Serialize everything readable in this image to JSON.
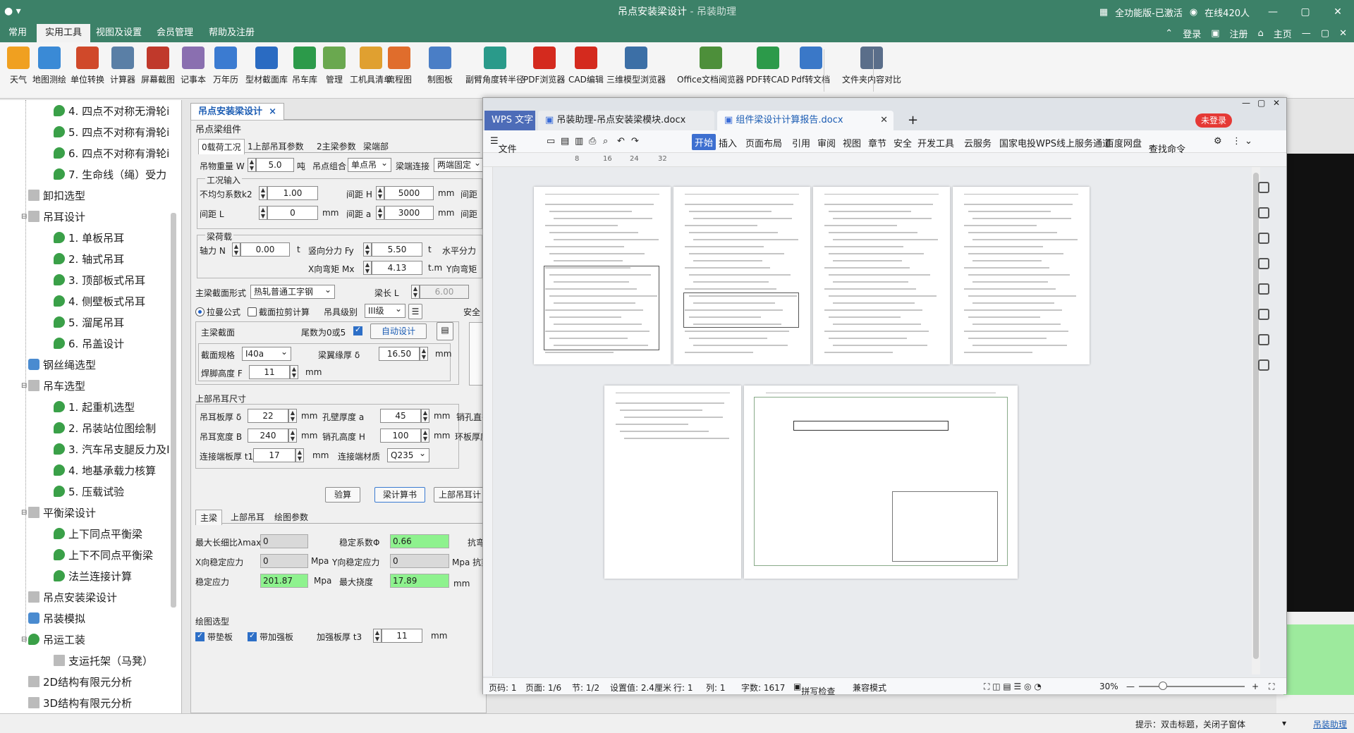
{
  "titlebar": {
    "title": "吊点安装梁设计",
    "subtitle": " - 吊装助理",
    "activation": "全功能版-已激活",
    "online": "在线420人"
  },
  "menubar": {
    "items": [
      "常用",
      "实用工具",
      "视图及设置",
      "会员管理",
      "帮助及注册"
    ],
    "active": "实用工具",
    "right": [
      "登录",
      "注册",
      "主页"
    ]
  },
  "toolbar": {
    "items": [
      {
        "label": "天气",
        "icon": "weather-icon",
        "color": "#f0a020"
      },
      {
        "label": "地图测绘",
        "icon": "map-icon",
        "color": "#3a8ad6"
      },
      {
        "label": "单位转换",
        "icon": "unit-convert-icon",
        "color": "#d0492a"
      },
      {
        "label": "计算器",
        "icon": "calculator-icon",
        "color": "#5a7fa6"
      },
      {
        "label": "屏幕截图",
        "icon": "scissors-icon",
        "color": "#c0392b"
      },
      {
        "label": "记事本",
        "icon": "notepad-icon",
        "color": "#8a6fb0"
      },
      {
        "label": "万年历",
        "icon": "calendar-icon",
        "color": "#3b7bd1"
      },
      {
        "label": "型材截面库",
        "icon": "i-beam-icon",
        "color": "#2a6bc2"
      },
      {
        "label": "吊车库",
        "icon": "crane-lib-icon",
        "color": "#2c9a4a"
      },
      {
        "label": "管理",
        "icon": "manage-icon",
        "color": "#6aa84f"
      },
      {
        "label": "工机具清单",
        "icon": "clipboard-icon",
        "color": "#e0a030"
      },
      {
        "label": "流程图",
        "icon": "flowchart-icon",
        "color": "#e06d2c"
      },
      {
        "label": "制图板",
        "icon": "drawing-board-icon",
        "color": "#4a7ec6"
      },
      {
        "label": "副臂角度转半径",
        "icon": "rotate-icon",
        "color": "#2a9a8a"
      },
      {
        "label": "PDF浏览器",
        "icon": "pdf-icon",
        "color": "#d42a1e"
      },
      {
        "label": "CAD编辑",
        "icon": "cad-icon",
        "color": "#d42a1e"
      },
      {
        "label": "三维模型浏览器",
        "icon": "3d-model-icon",
        "color": "#3c6fa6"
      },
      {
        "label": "Office文档阅览器",
        "icon": "office-doc-icon",
        "color": "#4d8f3a"
      },
      {
        "label": "PDF转CAD",
        "icon": "pdf-to-cad-icon",
        "color": "#2c9a4a"
      },
      {
        "label": "Pdf转文档",
        "icon": "pdf-to-doc-icon",
        "color": "#3a78c8"
      },
      {
        "label": "文件夹内容对比",
        "icon": "folder-compare-icon",
        "color": "#5a6e8a"
      }
    ]
  },
  "tree": {
    "items": [
      {
        "label": "4. 四点不对称无滑轮i",
        "level": 3,
        "icon": "green"
      },
      {
        "label": "5. 四点不对称有滑轮i",
        "level": 3,
        "icon": "green"
      },
      {
        "label": "6. 四点不对称有滑轮i",
        "level": 3,
        "icon": "green"
      },
      {
        "label": "7. 生命线（绳）受力",
        "level": 3,
        "icon": "green"
      },
      {
        "label": "卸扣选型",
        "level": 1,
        "icon": "grey"
      },
      {
        "label": "吊耳设计",
        "level": 1,
        "icon": "grey",
        "expander": "-"
      },
      {
        "label": "1. 单板吊耳",
        "level": 2,
        "icon": "green"
      },
      {
        "label": "2. 轴式吊耳",
        "level": 2,
        "icon": "green"
      },
      {
        "label": "3. 顶部板式吊耳",
        "level": 2,
        "icon": "green"
      },
      {
        "label": "4. 侧壁板式吊耳",
        "level": 2,
        "icon": "green"
      },
      {
        "label": "5. 溜尾吊耳",
        "level": 2,
        "icon": "green"
      },
      {
        "label": "6. 吊盖设计",
        "level": 2,
        "icon": "green"
      },
      {
        "label": "钢丝绳选型",
        "level": 1,
        "icon": "blue"
      },
      {
        "label": "吊车选型",
        "level": 1,
        "icon": "grey",
        "expander": "-"
      },
      {
        "label": "1. 起重机选型",
        "level": 2,
        "icon": "green"
      },
      {
        "label": "2. 吊装站位图绘制",
        "level": 2,
        "icon": "green"
      },
      {
        "label": "3. 汽车吊支腿反力及I",
        "level": 2,
        "icon": "green"
      },
      {
        "label": "4. 地基承载力核算",
        "level": 2,
        "icon": "green"
      },
      {
        "label": "5. 压载试验",
        "level": 2,
        "icon": "green"
      },
      {
        "label": "平衡梁设计",
        "level": 1,
        "icon": "grey",
        "expander": "-"
      },
      {
        "label": "上下同点平衡梁",
        "level": 2,
        "icon": "green"
      },
      {
        "label": "上下不同点平衡梁",
        "level": 2,
        "icon": "green"
      },
      {
        "label": "法兰连接计算",
        "level": 2,
        "icon": "green"
      },
      {
        "label": "吊点安装梁设计",
        "level": 1,
        "icon": "grey"
      },
      {
        "label": "吊装模拟",
        "level": 1,
        "icon": "blue"
      },
      {
        "label": "吊运工装",
        "level": 1,
        "icon": "green",
        "expander": "-"
      },
      {
        "label": "支运托架（马凳）",
        "level": 2,
        "icon": "grey"
      },
      {
        "label": "2D结构有限元分析",
        "level": 1,
        "icon": "grey"
      },
      {
        "label": "3D结构有限元分析",
        "level": 1,
        "icon": "grey"
      }
    ]
  },
  "doc_tab": {
    "label": "吊点安装梁设计",
    "close": "×"
  },
  "form": {
    "group_title": "吊点梁组件",
    "tabs": [
      "0载荷工况",
      "1上部吊耳参数",
      "2主梁参数",
      "梁端部"
    ],
    "row1": {
      "weight_label": "吊物重量 W",
      "weight": "5.0",
      "weight_unit": "吨",
      "combo_label": "吊点组合",
      "combo": "单点吊",
      "end_label": "梁端连接",
      "end": "两端固定"
    },
    "case_group": "工况输入",
    "k2_label": "不均匀系数k2",
    "k2": "1.00",
    "L_label": "间距 L",
    "L": "0",
    "L_unit": "mm",
    "H_label": "间距 H",
    "H": "5000",
    "H_unit": "mm",
    "a_label": "间距 a",
    "a": "3000",
    "a_unit": "mm",
    "more_label": "间距",
    "load_group": "梁荷载",
    "N_label": "轴力 N",
    "N": "0.00",
    "N_unit": "t",
    "Fy_label": "竖向分力 Fy",
    "Fy": "5.50",
    "Fy_unit": "t",
    "Fx_label": "水平分力",
    "Mx_label": "X向弯矩 Mx",
    "Mx": "4.13",
    "Mx_unit": "t.m",
    "My_label": "Y向弯矩",
    "section_form_label": "主梁截面形式",
    "section_form": "热轧普通工字钢",
    "beam_len_label": "梁长 L",
    "beam_len": "6.00",
    "radio1": "拉曼公式",
    "radio2": "截面拉剪计算",
    "grade_label": "吊具级别",
    "grade": "III级",
    "safety_label": "安全",
    "main_section_label": "主梁截面",
    "tail_label": "尾数为0或5",
    "auto_design": "自动设计",
    "spec_label": "截面规格",
    "spec": "I40a",
    "flange_label": "梁翼缘厚 δ",
    "flange": "16.50",
    "weld_label": "焊脚高度 F",
    "weld": "11",
    "weld_unit": "mm",
    "lug_title": "上部吊耳尺寸",
    "lug_thick_label": "吊耳板厚 δ",
    "lug_thick": "22",
    "hole_thick_label": "孔壁厚度 a",
    "hole_thick": "45",
    "pin_label": "销孔直径",
    "lug_width_label": "吊耳宽度 B",
    "lug_width": "240",
    "hole_height_label": "销孔高度 H",
    "hole_height": "100",
    "ring_label": "环板厚度",
    "conn_label": "连接端板厚 t1",
    "conn": "17",
    "mat_label": "连接端材质",
    "mat": "Q235",
    "mm": "mm",
    "btn_check": "验算",
    "btn_report": "梁计算书",
    "btn_lug": "上部吊耳计",
    "result_tabs": [
      "主梁",
      "上部吊耳",
      "绘图参数"
    ],
    "slender_label": "最大长细比λmax",
    "slender": "0",
    "stab_coef_label": "稳定系数Φ",
    "stab_coef": "0.66",
    "resist_label": "抗弯",
    "x_stab_label": "X向稳定应力",
    "x_stab": "0",
    "mpa": "Mpa",
    "y_stab_label": "Y向稳定应力",
    "y_stab": "0",
    "shear_label": "Mpa 抗剪",
    "stab_label": "稳定应力",
    "stab": "201.87",
    "defl_label": "最大挠度",
    "defl": "17.89",
    "draw_title": "绘图选型",
    "pad_label": "带垫板",
    "rib_label": "带加强板",
    "rib_thick_label": "加强板厚 t3",
    "rib_thick": "11"
  },
  "statusbar": {
    "hint": "提示：双击标题，关闭子窗体",
    "link": "吊装助理"
  },
  "wps": {
    "tabs": [
      "WPS 文字",
      "吊装助理-吊点安装梁模块.docx",
      "组件梁设计计算报告.docx"
    ],
    "login": "未登录",
    "menu": [
      "文件",
      "开始",
      "插入",
      "页面布局",
      "引用",
      "审阅",
      "视图",
      "章节",
      "安全",
      "开发工具",
      "云服务",
      "国家电投WPS线上服务通道",
      "百度网盘",
      "查找命令"
    ],
    "ruler": [
      "8",
      "16",
      "24",
      "32"
    ],
    "status": {
      "page": "页码: 1",
      "pages": "页面: 1/6",
      "section": "节: 1/2",
      "setting": "设置值: 2.4厘米",
      "row": "行: 1",
      "col": "列: 1",
      "words": "字数: 1617",
      "spell": "拼写检查",
      "compat": "兼容模式",
      "zoom": "30%"
    }
  }
}
